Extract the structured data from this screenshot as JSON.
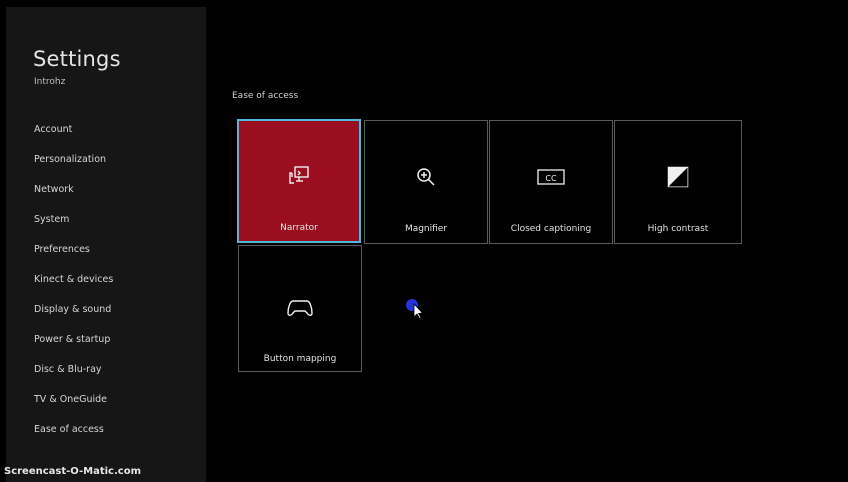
{
  "sidebar": {
    "title": "Settings",
    "user": "Introhz",
    "items": [
      {
        "label": "Account"
      },
      {
        "label": "Personalization"
      },
      {
        "label": "Network"
      },
      {
        "label": "System"
      },
      {
        "label": "Preferences"
      },
      {
        "label": "Kinect & devices"
      },
      {
        "label": "Display & sound"
      },
      {
        "label": "Power & startup"
      },
      {
        "label": "Disc & Blu-ray"
      },
      {
        "label": "TV & OneGuide"
      },
      {
        "label": "Ease of access"
      }
    ]
  },
  "main": {
    "section_title": "Ease of access",
    "tiles": [
      {
        "label": "Narrator",
        "icon": "narrator-icon",
        "selected": true
      },
      {
        "label": "Magnifier",
        "icon": "magnifier-icon"
      },
      {
        "label": "Closed captioning",
        "icon": "closed-captioning-icon",
        "icon_text": "CC"
      },
      {
        "label": "High contrast",
        "icon": "high-contrast-icon"
      },
      {
        "label": "Button mapping",
        "icon": "controller-icon"
      }
    ]
  },
  "watermark": "Screencast-O-Matic.com",
  "colors": {
    "selected_tile": "#9b0e1f",
    "focus_border": "#4fb8d8",
    "sidebar_bg": "#161616",
    "background": "#000000"
  }
}
